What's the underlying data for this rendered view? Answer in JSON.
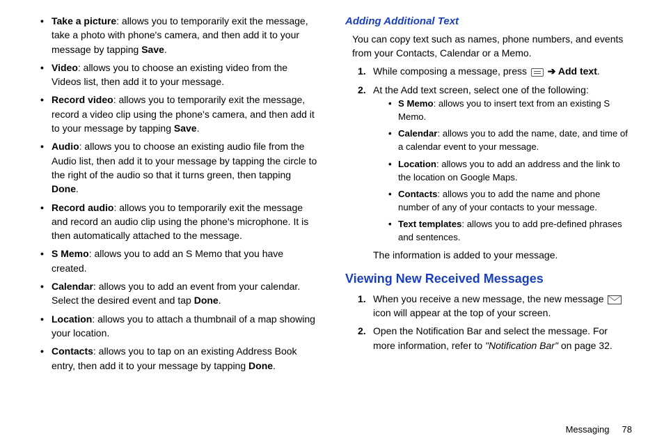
{
  "left": {
    "items": [
      {
        "label": "Take a picture",
        "desc": ": allows you to temporarily exit the message, take a photo with phone's camera, and then add it to your message by tapping ",
        "tail_bold": "Save",
        "tail_after": "."
      },
      {
        "label": "Video",
        "desc": ": allows you to choose an existing video from the Videos list, then add it to your message."
      },
      {
        "label": "Record video",
        "desc": ": allows you to temporarily exit the message, record a video clip using the phone's camera, and then add it to your message by tapping ",
        "tail_bold": "Save",
        "tail_after": "."
      },
      {
        "label": "Audio",
        "desc": ": allows you to choose an existing audio file from the Audio list, then add it to your message by tapping the circle to the right of the audio so that it turns green, then tapping ",
        "tail_bold": "Done",
        "tail_after": "."
      },
      {
        "label": "Record audio",
        "desc": ": allows you to temporarily exit the message and record an audio clip using the phone's microphone. It is then automatically attached to the message."
      },
      {
        "label": "S Memo",
        "desc": ": allows you to add an S Memo that you have created."
      },
      {
        "label": "Calendar",
        "desc": ": allows you to add an event from your calendar. Select the desired event and tap ",
        "tail_bold": "Done",
        "tail_after": "."
      },
      {
        "label": "Location",
        "desc": ": allows you to attach a thumbnail of a map showing your location."
      },
      {
        "label": "Contacts",
        "desc": ": allows you to tap on an existing Address Book entry, then add it to your message by tapping ",
        "tail_bold": "Done",
        "tail_after": "."
      }
    ]
  },
  "right": {
    "heading_addtext": "Adding Additional Text",
    "addtext_intro": "You can copy text such as names, phone numbers, and events from your Contacts, Calendar or a Memo.",
    "steps1": {
      "s1_a": "While composing a message, press ",
      "s1_arrow": " ➔ ",
      "s1_bold": "Add text",
      "s1_after": ".",
      "s2": "At the Add text screen, select one of the following:"
    },
    "sub_items": [
      {
        "label": "S Memo",
        "desc": ": allows you to insert text from an existing S Memo."
      },
      {
        "label": "Calendar",
        "desc": ": allows you to add the name, date, and time of a calendar event to your message."
      },
      {
        "label": "Location",
        "desc": ": allows you to add an address and the link to the location on Google Maps."
      },
      {
        "label": "Contacts",
        "desc": ": allows you to add the name and phone number of any of your contacts to your message."
      },
      {
        "label": "Text templates",
        "desc": ": allows you to add pre-defined phrases and sentences."
      }
    ],
    "addtext_trail": "The information is added to your message.",
    "heading_viewing": "Viewing New Received Messages",
    "view_s1_a": "When you receive a new message, the new message ",
    "view_s1_b": " icon will appear at the top of your screen.",
    "view_s2_a": "Open the Notification Bar and select the message. For more information, refer to ",
    "view_s2_ref": "\"Notification Bar\"",
    "view_s2_b": "  on page 32."
  },
  "footer": {
    "section": "Messaging",
    "page": "78"
  }
}
